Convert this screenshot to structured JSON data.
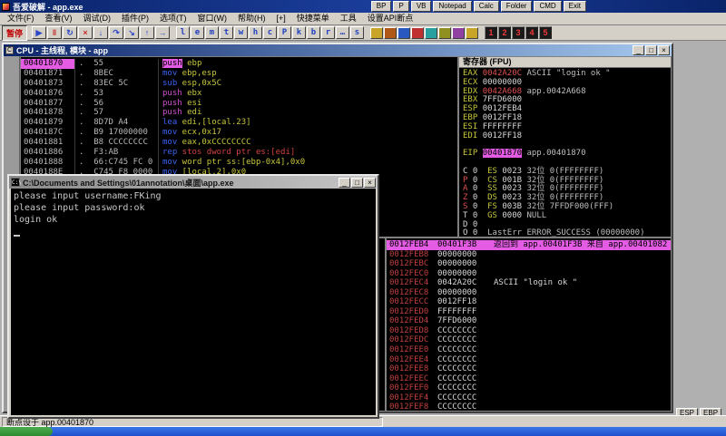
{
  "colors": {
    "titlebar_blue": "#0a246a",
    "panel_gray": "#d4d0c8",
    "highlight_magenta": "#e35ce3",
    "syntax_blue": "#3b63f5",
    "syntax_magenta": "#ce4fce",
    "syntax_yellow": "#c6c63c",
    "syntax_red": "#d14040",
    "changed_value_red": "#e05050",
    "stack_addr_red": "#c04040",
    "console_text": "#c8c8c8"
  },
  "app_titlebar": {
    "title": "吾爱破解 - app.exe",
    "buttons": [
      "BP",
      "P",
      "VB",
      "Notepad",
      "Calc",
      "Folder",
      "CMD",
      "Exit"
    ]
  },
  "menubar": {
    "items": [
      "文件(F)",
      "查看(V)",
      "调试(D)",
      "插件(P)",
      "选项(T)",
      "窗口(W)",
      "帮助(H)",
      "[+]",
      "快捷菜单",
      "工具",
      "设置API断点"
    ]
  },
  "toolbar": {
    "pause_label": "暂停",
    "icon_buttons": [
      {
        "name": "run-icon",
        "glyph": "▶",
        "color": "#2a48c8"
      },
      {
        "name": "pause-icon",
        "glyph": "‖",
        "color": "#c82a2a"
      },
      {
        "name": "restart-icon",
        "glyph": "↻",
        "color": "#2a48c8"
      },
      {
        "name": "close-program-icon",
        "glyph": "×",
        "color": "#c82a2a"
      },
      {
        "name": "step-into-icon",
        "glyph": "↓",
        "color": "#2a48c8"
      },
      {
        "name": "step-over-icon",
        "glyph": "↷",
        "color": "#2a48c8"
      },
      {
        "name": "trace-into-icon",
        "glyph": "↘",
        "color": "#2a48c8"
      },
      {
        "name": "run-to-return-icon",
        "glyph": "↑",
        "color": "#2a48c8"
      },
      {
        "name": "goto-icon",
        "glyph": "→",
        "color": "#2a48c8"
      }
    ],
    "letter_buttons": [
      "l",
      "e",
      "m",
      "t",
      "w",
      "h",
      "c",
      "P",
      "k",
      "b",
      "r",
      "…",
      "s"
    ],
    "plugin_icons": [
      {
        "name": "plugin-icon-1",
        "color": "#c8a428"
      },
      {
        "name": "plugin-icon-2",
        "color": "#b05818"
      },
      {
        "name": "plugin-icon-3",
        "color": "#2858c0"
      },
      {
        "name": "plugin-icon-4",
        "color": "#c03030"
      },
      {
        "name": "plugin-icon-5",
        "color": "#28a0a0"
      },
      {
        "name": "plugin-icon-6",
        "color": "#909020"
      },
      {
        "name": "plugin-icon-7",
        "color": "#9040a0"
      },
      {
        "name": "plugin-icon-8",
        "color": "#c8a428"
      }
    ],
    "number_buttons": [
      "1",
      "2",
      "3",
      "4",
      "5"
    ]
  },
  "cpu_window": {
    "title": "CPU - 主线程, 模块 - app",
    "controls": [
      {
        "name": "minimize-icon",
        "glyph": "_"
      },
      {
        "name": "restore-icon",
        "glyph": "□"
      },
      {
        "name": "close-icon",
        "glyph": "×"
      }
    ]
  },
  "disasm": {
    "rows": [
      {
        "addr": "00401870",
        "bytes": ".  55",
        "segs": [
          [
            "push",
            "m"
          ],
          [
            " ebp",
            "y"
          ]
        ],
        "selected": true
      },
      {
        "addr": "00401871",
        "bytes": ".  8BEC",
        "segs": [
          [
            "mov",
            "b"
          ],
          [
            " ebp,esp",
            "y"
          ]
        ]
      },
      {
        "addr": "00401873",
        "bytes": ".  83EC 5C",
        "segs": [
          [
            "sub",
            "b"
          ],
          [
            " esp,0x5C",
            "y"
          ]
        ]
      },
      {
        "addr": "00401876",
        "bytes": ".  53",
        "segs": [
          [
            "push",
            "m"
          ],
          [
            " ebx",
            "y"
          ]
        ]
      },
      {
        "addr": "00401877",
        "bytes": ".  56",
        "segs": [
          [
            "push",
            "m"
          ],
          [
            " esi",
            "y"
          ]
        ]
      },
      {
        "addr": "00401878",
        "bytes": ".  57",
        "segs": [
          [
            "push",
            "m"
          ],
          [
            " edi",
            "y"
          ]
        ]
      },
      {
        "addr": "00401879",
        "bytes": ".  8D7D A4",
        "segs": [
          [
            "lea",
            "b"
          ],
          [
            " edi,[local.23]",
            "y"
          ]
        ]
      },
      {
        "addr": "0040187C",
        "bytes": ".  B9 17000000",
        "segs": [
          [
            "mov",
            "b"
          ],
          [
            " ecx,0x17",
            "y"
          ]
        ]
      },
      {
        "addr": "00401881",
        "bytes": ".  B8 CCCCCCCC",
        "segs": [
          [
            "mov",
            "b"
          ],
          [
            " eax,0xCCCCCCCC",
            "y"
          ]
        ]
      },
      {
        "addr": "00401886",
        "bytes": ".  F3:AB",
        "segs": [
          [
            "rep",
            "b"
          ],
          [
            " stos dword ptr es:[edi]",
            "r"
          ]
        ]
      },
      {
        "addr": "00401888",
        "bytes": ".  66:C745 FC 0",
        "segs": [
          [
            "mov",
            "b"
          ],
          [
            " word ptr ss:[ebp-0x4],0x0",
            "y"
          ]
        ]
      },
      {
        "addr": "0040188E",
        "bytes": ".  C745 F8 0000",
        "segs": [
          [
            "mov",
            "b"
          ],
          [
            " [local.2],0x0",
            "y"
          ]
        ]
      }
    ]
  },
  "registers": {
    "title": "寄存器 (FPU)",
    "rows": [
      {
        "name": "EAX",
        "value": "0042A20C",
        "extra": "ASCII \"login ok \"",
        "changed": true
      },
      {
        "name": "ECX",
        "value": "00000000"
      },
      {
        "name": "EDX",
        "value": "0042A668",
        "extra": "app.0042A668",
        "changed": true
      },
      {
        "name": "EBX",
        "value": "7FFD6000"
      },
      {
        "name": "ESP",
        "value": "0012FEB4"
      },
      {
        "name": "EBP",
        "value": "0012FF18"
      },
      {
        "name": "ESI",
        "value": "FFFFFFFF"
      },
      {
        "name": "EDI",
        "value": "0012FF18"
      },
      {
        "spacer": true
      },
      {
        "name": "EIP",
        "value": "00401870",
        "extra": "app.00401870",
        "eip": true
      },
      {
        "spacer": true
      }
    ],
    "flags": [
      {
        "flag": "C",
        "value": "0",
        "seg": "ES",
        "segval": "0023",
        "rest": "32位 0(FFFFFFFF)",
        "changed": false
      },
      {
        "flag": "P",
        "value": "0",
        "seg": "CS",
        "segval": "001B",
        "rest": "32位 0(FFFFFFFF)",
        "changed": true
      },
      {
        "flag": "A",
        "value": "0",
        "seg": "SS",
        "segval": "0023",
        "rest": "32位 0(FFFFFFFF)",
        "changed": true
      },
      {
        "flag": "Z",
        "value": "0",
        "seg": "DS",
        "segval": "0023",
        "rest": "32位 0(FFFFFFFF)",
        "changed": true
      },
      {
        "flag": "S",
        "value": "0",
        "seg": "FS",
        "segval": "003B",
        "rest": "32位 7FFDF000(FFF)",
        "changed": true
      },
      {
        "flag": "T",
        "value": "0",
        "seg": "GS",
        "segval": "0000",
        "rest": "NULL",
        "changed": false
      },
      {
        "flag": "D",
        "value": "0",
        "seg": "",
        "segval": "",
        "rest": "",
        "changed": false
      },
      {
        "flag": "O",
        "value": "0",
        "seg": "",
        "segval": "",
        "rest": "LastErr ERROR_SUCCESS (00000000)",
        "changed": false
      }
    ]
  },
  "console": {
    "title": "C:\\Documents and Settings\\01annotation\\桌面\\app.exe",
    "lines": [
      "please input username:FKing",
      "please input password:ok",
      "login ok"
    ],
    "controls": [
      {
        "name": "minimize-icon",
        "glyph": "_"
      },
      {
        "name": "maximize-icon",
        "glyph": "□"
      },
      {
        "name": "close-icon",
        "glyph": "×"
      }
    ]
  },
  "stack": {
    "rows": [
      {
        "addr": "0012FEB4",
        "value": "00401F3B",
        "comment": "返回到 app.00401F3B 来自 app.00401082",
        "selected": true
      },
      {
        "addr": "0012FEB8",
        "value": "00000000",
        "comment": ""
      },
      {
        "addr": "0012FEBC",
        "value": "00000000",
        "comment": ""
      },
      {
        "addr": "0012FEC0",
        "value": "00000000",
        "comment": ""
      },
      {
        "addr": "0012FEC4",
        "value": "0042A20C",
        "comment": "ASCII \"login ok \""
      },
      {
        "addr": "0012FEC8",
        "value": "00000000",
        "comment": ""
      },
      {
        "addr": "0012FECC",
        "value": "0012FF18",
        "comment": ""
      },
      {
        "addr": "0012FED0",
        "value": "FFFFFFFF",
        "comment": ""
      },
      {
        "addr": "0012FED4",
        "value": "7FFD6000",
        "comment": ""
      },
      {
        "addr": "0012FED8",
        "value": "CCCCCCCC",
        "comment": ""
      },
      {
        "addr": "0012FEDC",
        "value": "CCCCCCCC",
        "comment": ""
      },
      {
        "addr": "0012FEE0",
        "value": "CCCCCCCC",
        "comment": ""
      },
      {
        "addr": "0012FEE4",
        "value": "CCCCCCCC",
        "comment": ""
      },
      {
        "addr": "0012FEE8",
        "value": "CCCCCCCC",
        "comment": ""
      },
      {
        "addr": "0012FEEC",
        "value": "CCCCCCCC",
        "comment": ""
      },
      {
        "addr": "0012FEF0",
        "value": "CCCCCCCC",
        "comment": ""
      },
      {
        "addr": "0012FEF4",
        "value": "CCCCCCCC",
        "comment": ""
      },
      {
        "addr": "0012FEF8",
        "value": "CCCCCCCC",
        "comment": ""
      }
    ]
  },
  "statusbar": {
    "text": "断点设于 app.00401870"
  },
  "side_buttons": [
    "ESP",
    "EBP"
  ]
}
